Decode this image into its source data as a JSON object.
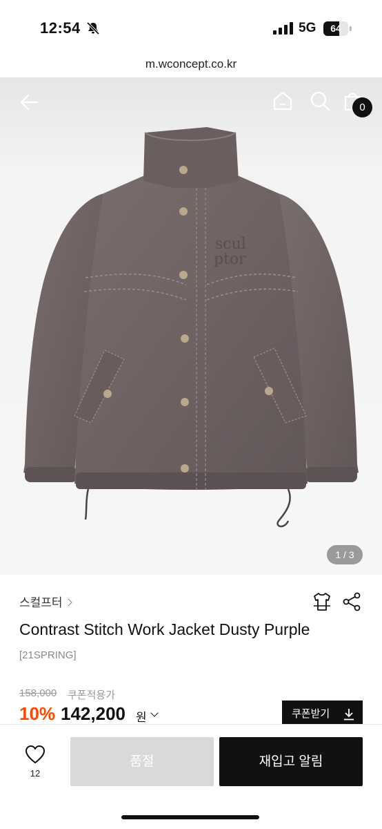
{
  "status_bar": {
    "time": "12:54",
    "network": "5G",
    "battery": 64,
    "battery_label": "64",
    "icons": [
      "bell-slash-icon",
      "signal-icon",
      "battery-icon"
    ]
  },
  "browser": {
    "url": "m.wconcept.co.kr"
  },
  "header": {
    "icons": [
      "back-arrow-icon",
      "home-icon",
      "search-icon",
      "shopping-bag-icon"
    ],
    "cart_count": "0"
  },
  "gallery": {
    "counter": "1 / 3",
    "embroidery_line1": "scul",
    "embroidery_line2": "ptor"
  },
  "product": {
    "brand": "스컬프터",
    "name": "Contrast Stitch Work Jacket Dusty Purple",
    "season": "[21SPRING]",
    "original_price": "158,000",
    "coupon_note": "쿠폰적용가",
    "discount_rate": "10%",
    "sale_price": "142,200",
    "currency": "원",
    "coupon_button": "쿠폰받기",
    "accent_color": "#ff4800"
  },
  "bottom_bar": {
    "like_count": "12",
    "soldout_label": "품절",
    "restock_label": "재입고 알림"
  }
}
